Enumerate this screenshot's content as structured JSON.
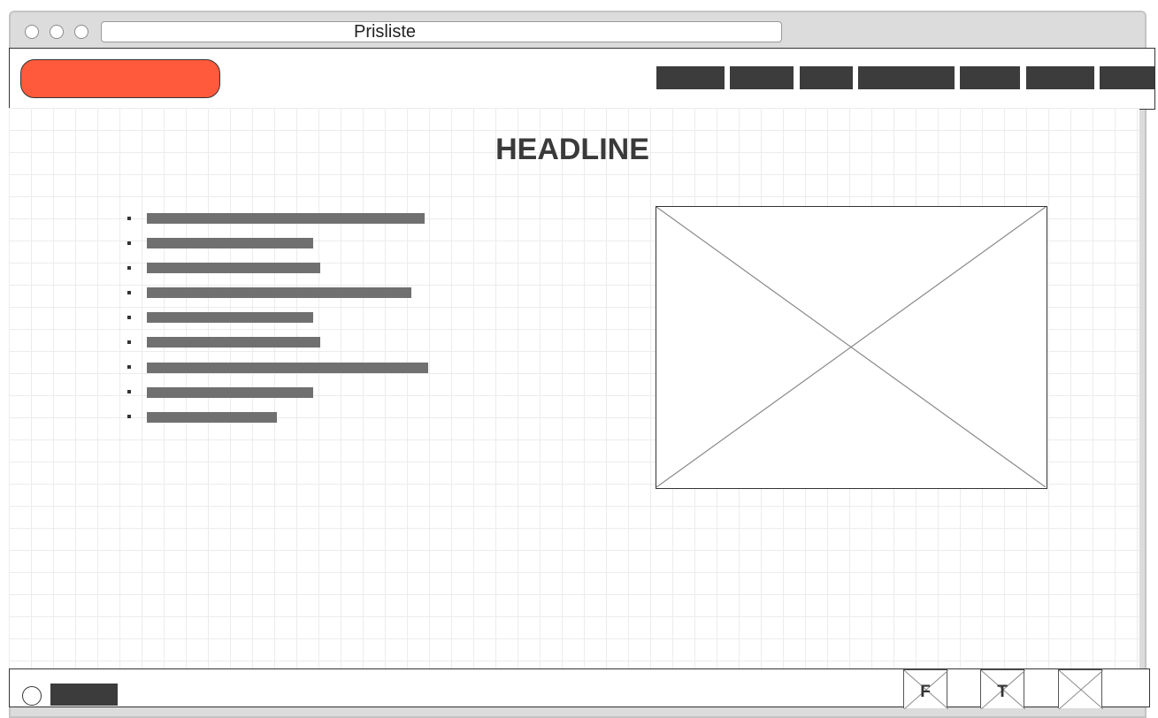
{
  "browser": {
    "title": "Prisliste"
  },
  "colors": {
    "logo": "#ff5a3c",
    "nav_block": "#3c3c3c",
    "text_bar": "#707070"
  },
  "header": {
    "logo": "logo-placeholder",
    "nav_item_count": 7
  },
  "main": {
    "headline": "HEADLINE",
    "list_item_count": 9,
    "image": "image-placeholder"
  },
  "footer": {
    "social_icons": [
      {
        "label": "F",
        "icon": "facebook-icon"
      },
      {
        "label": "T",
        "icon": "twitter-icon"
      },
      {
        "label": "",
        "icon": "image-icon"
      }
    ]
  }
}
